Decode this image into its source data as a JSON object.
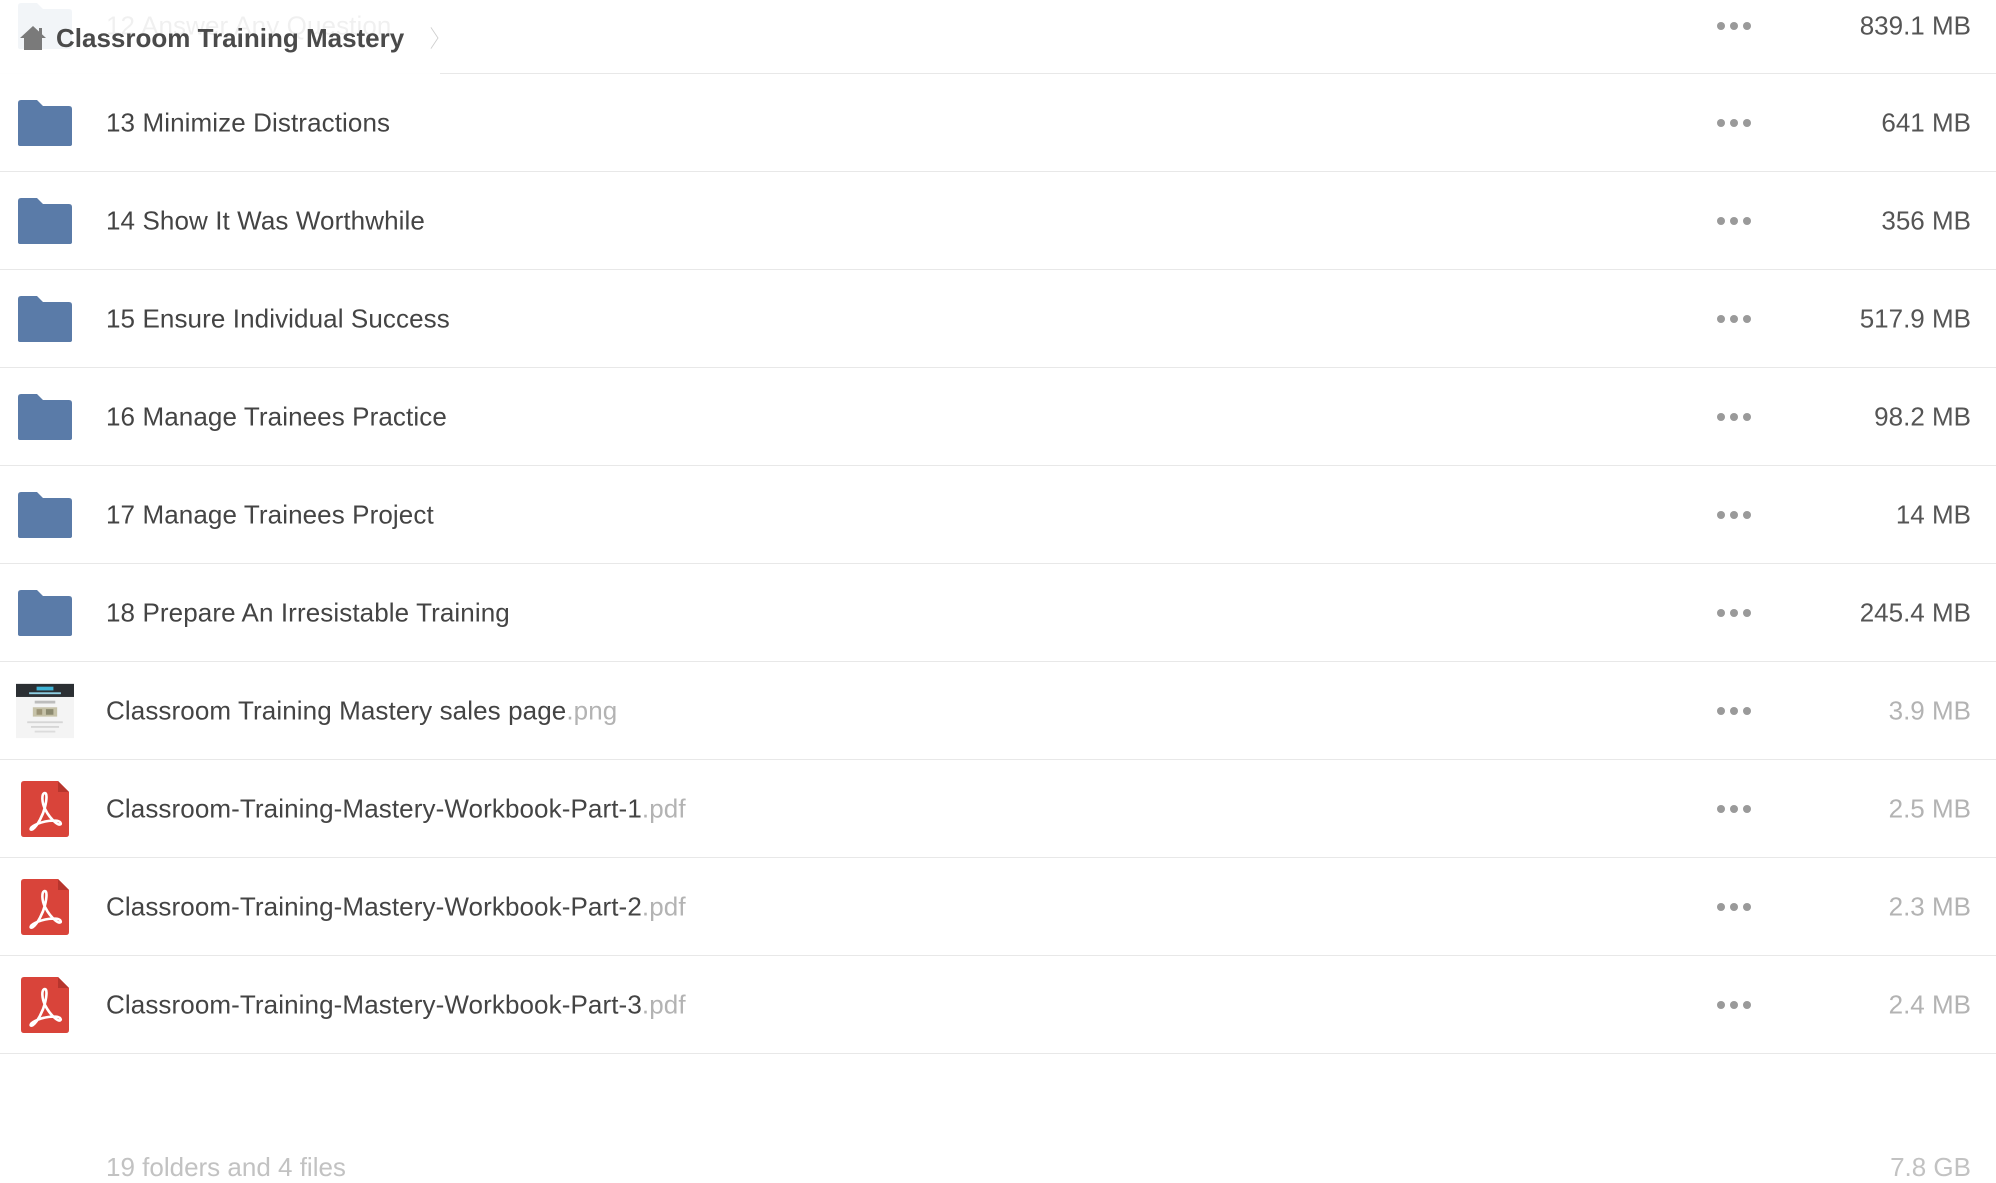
{
  "breadcrumb": {
    "label": "Classroom Training Mastery"
  },
  "icons": {
    "folder": "folder-icon",
    "pdf": "pdf-icon",
    "image": "image-thumbnail",
    "home": "home-icon",
    "more": "more-options-icon"
  },
  "colors": {
    "folder": "#5a7ba8",
    "pdf": "#d9443a",
    "text": "#444444",
    "muted": "#b3b3b3"
  },
  "items": [
    {
      "name": "12 Answer Any Question",
      "ext": "",
      "size": "839.1 MB",
      "type": "folder"
    },
    {
      "name": "13 Minimize Distractions",
      "ext": "",
      "size": "641 MB",
      "type": "folder"
    },
    {
      "name": "14 Show It Was Worthwhile",
      "ext": "",
      "size": "356 MB",
      "type": "folder"
    },
    {
      "name": "15 Ensure Individual Success",
      "ext": "",
      "size": "517.9 MB",
      "type": "folder"
    },
    {
      "name": "16 Manage Trainees Practice",
      "ext": "",
      "size": "98.2 MB",
      "type": "folder"
    },
    {
      "name": "17 Manage Trainees Project",
      "ext": "",
      "size": "14 MB",
      "type": "folder"
    },
    {
      "name": "18 Prepare An Irresistable Training",
      "ext": "",
      "size": "245.4 MB",
      "type": "folder"
    },
    {
      "name": "Classroom Training Mastery sales page",
      "ext": ".png",
      "size": "3.9 MB",
      "type": "image"
    },
    {
      "name": "Classroom-Training-Mastery-Workbook-Part-1",
      "ext": ".pdf",
      "size": "2.5 MB",
      "type": "pdf"
    },
    {
      "name": "Classroom-Training-Mastery-Workbook-Part-2",
      "ext": ".pdf",
      "size": "2.3 MB",
      "type": "pdf"
    },
    {
      "name": "Classroom-Training-Mastery-Workbook-Part-3",
      "ext": ".pdf",
      "size": "2.4 MB",
      "type": "pdf"
    }
  ],
  "footer": {
    "summary": "19 folders and 4 files",
    "total": "7.8 GB"
  }
}
